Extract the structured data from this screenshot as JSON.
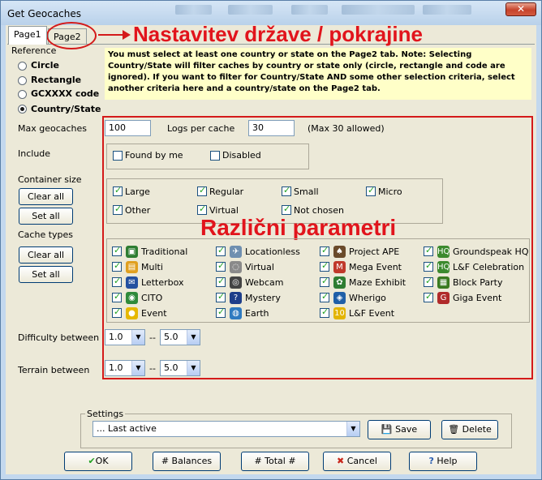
{
  "window": {
    "title": "Get Geocaches",
    "close_glyph": "✕"
  },
  "tabs": [
    {
      "label": "Page1"
    },
    {
      "label": "Page2"
    }
  ],
  "annotations": {
    "country_state": "Nastavitev države / pokrajine",
    "parameters": "Različni parametri"
  },
  "reference": {
    "label": "Reference",
    "options": [
      {
        "label": "Circle",
        "selected": false
      },
      {
        "label": "Rectangle",
        "selected": false
      },
      {
        "label": "GCXXXX code",
        "selected": false
      },
      {
        "label": "Country/State",
        "selected": true
      }
    ]
  },
  "note": "You must select at least one country or state on the Page2 tab. Note: Selecting Country/State will filter caches by country or state only (circle, rectangle and code are ignored). If you want to filter for Country/State AND some other selection criteria, select another criteria here and a country/state on the Page2 tab.",
  "max_geocaches": {
    "label": "Max geocaches",
    "value": "100"
  },
  "logs_per_cache": {
    "label": "Logs per cache",
    "value": "30",
    "hint": "(Max 30 allowed)"
  },
  "include": {
    "label": "Include",
    "options": [
      {
        "label": "Found by me",
        "checked": false
      },
      {
        "label": "Disabled",
        "checked": false
      }
    ]
  },
  "container_size": {
    "label": "Container size",
    "clear_all": "Clear all",
    "set_all": "Set all",
    "options": [
      {
        "label": "Large",
        "checked": true
      },
      {
        "label": "Regular",
        "checked": true
      },
      {
        "label": "Small",
        "checked": true
      },
      {
        "label": "Micro",
        "checked": true
      },
      {
        "label": "Other",
        "checked": true
      },
      {
        "label": "Virtual",
        "checked": true
      },
      {
        "label": "Not chosen",
        "checked": true
      }
    ]
  },
  "cache_types": {
    "label": "Cache types",
    "clear_all": "Clear all",
    "set_all": "Set all",
    "items": [
      {
        "label": "Traditional",
        "icon": "traditional-cache-icon",
        "color": "#2e7d32",
        "glyph": "▣"
      },
      {
        "label": "Multi",
        "icon": "multi-cache-icon",
        "color": "#e0a020",
        "glyph": "▤"
      },
      {
        "label": "Letterbox",
        "icon": "letterbox-icon",
        "color": "#2350a0",
        "glyph": "✉"
      },
      {
        "label": "CITO",
        "icon": "cito-icon",
        "color": "#2f8a3a",
        "glyph": "◉"
      },
      {
        "label": "Event",
        "icon": "event-icon",
        "color": "#e6b800",
        "glyph": "●"
      },
      {
        "label": "Locationless",
        "icon": "locationless-icon",
        "color": "#6f8fb0",
        "glyph": "✈"
      },
      {
        "label": "Virtual",
        "icon": "virtual-cache-icon",
        "color": "#8a8a8a",
        "glyph": "◌"
      },
      {
        "label": "Webcam",
        "icon": "webcam-icon",
        "color": "#444444",
        "glyph": "◎"
      },
      {
        "label": "Mystery",
        "icon": "mystery-icon",
        "color": "#1e3e8a",
        "glyph": "?"
      },
      {
        "label": "Earth",
        "icon": "earthcache-icon",
        "color": "#2f7ac0",
        "glyph": "◍"
      },
      {
        "label": "Project APE",
        "icon": "project-ape-icon",
        "color": "#6a4a2a",
        "glyph": "♠"
      },
      {
        "label": "Mega Event",
        "icon": "mega-event-icon",
        "color": "#c0392b",
        "glyph": "M"
      },
      {
        "label": "Maze Exhibit",
        "icon": "maze-exhibit-icon",
        "color": "#2e7d32",
        "glyph": "✿"
      },
      {
        "label": "Wherigo",
        "icon": "wherigo-icon",
        "color": "#1f5fa8",
        "glyph": "◈"
      },
      {
        "label": "L&F Event",
        "icon": "lf-event-icon",
        "color": "#e3b400",
        "glyph": "10"
      },
      {
        "label": "Groundspeak HQ",
        "icon": "groundspeak-hq-icon",
        "color": "#3c8a2e",
        "glyph": "HQ"
      },
      {
        "label": "L&F Celebration",
        "icon": "lf-celebration-icon",
        "color": "#3c8a2e",
        "glyph": "HQ"
      },
      {
        "label": "Block Party",
        "icon": "block-party-icon",
        "color": "#3a7a20",
        "glyph": "▦"
      },
      {
        "label": "Giga Event",
        "icon": "giga-event-icon",
        "color": "#b02a2a",
        "glyph": "G"
      }
    ]
  },
  "difficulty": {
    "label": "Difficulty between",
    "from": "1.0",
    "sep": "--",
    "to": "5.0"
  },
  "terrain": {
    "label": "Terrain between",
    "from": "1.0",
    "sep": "--",
    "to": "5.0"
  },
  "settings": {
    "label": "Settings",
    "selected": "... Last active",
    "save": "Save",
    "delete": "Delete"
  },
  "footer": {
    "ok": "OK",
    "balances": "Balances",
    "total": "Total #",
    "cancel": "Cancel",
    "help": "Help"
  }
}
